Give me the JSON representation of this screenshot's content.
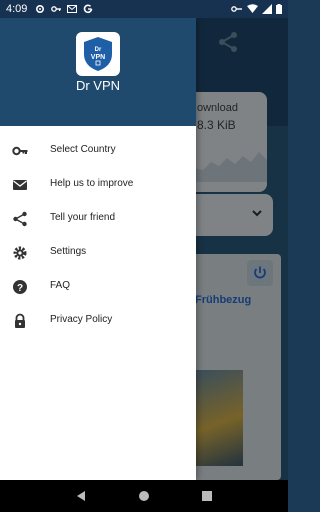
{
  "status_bar": {
    "time": "4:09",
    "left_icons": [
      "gear-icon",
      "key-icon",
      "mail-icon",
      "google-icon"
    ],
    "right_icons": [
      "vpn-key-icon",
      "wifi-icon",
      "signal-icon",
      "battery-icon"
    ]
  },
  "background": {
    "download_label": "ownload",
    "download_value": "8.3 KiB",
    "promo_text": "Frühbezug"
  },
  "drawer": {
    "logo_text_top": "Dr",
    "logo_text_mid": "VPN",
    "app_title": "Dr VPN",
    "items": [
      {
        "label": "Select Country",
        "icon": "key-icon"
      },
      {
        "label": "Help us to improve",
        "icon": "mail-icon"
      },
      {
        "label": "Tell your friend",
        "icon": "share-icon"
      },
      {
        "label": "Settings",
        "icon": "gear-icon"
      },
      {
        "label": "FAQ",
        "icon": "help-icon"
      },
      {
        "label": "Privacy Policy",
        "icon": "lock-icon"
      }
    ]
  },
  "colors": {
    "header": "#1f4a6d",
    "status_bar": "#173150",
    "accent": "#2b6fd8"
  }
}
